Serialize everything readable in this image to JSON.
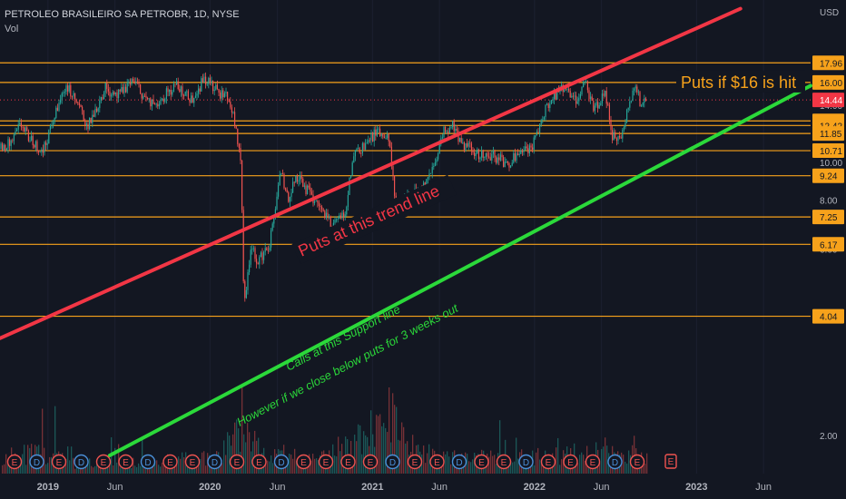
{
  "header": {
    "symbol_line": "PETROLEO BRASILEIRO SA PETROBR, 1D, NYSE",
    "vol_label": "Vol"
  },
  "chart_data": {
    "type": "candlestick",
    "currency": "USD",
    "y_scale": "log",
    "ylim": [
      1.6,
      26
    ],
    "x_range": [
      "2018-09-15",
      "2023-09-15"
    ],
    "y_ticks": [
      "2.00",
      "4.00",
      "6.00",
      "8.00",
      "10.00",
      "12.00",
      "14.00"
    ],
    "x_ticks": [
      {
        "label": "2019",
        "date": "2019-01-01"
      },
      {
        "label": "Jun",
        "date": "2019-06-01"
      },
      {
        "label": "2020",
        "date": "2020-01-01"
      },
      {
        "label": "Jun",
        "date": "2020-06-01"
      },
      {
        "label": "2021",
        "date": "2021-01-01"
      },
      {
        "label": "Jun",
        "date": "2021-06-01"
      },
      {
        "label": "2022",
        "date": "2022-01-01"
      },
      {
        "label": "Jun",
        "date": "2022-06-01"
      },
      {
        "label": "2023",
        "date": "2023-01-01"
      },
      {
        "label": "Jun",
        "date": "2023-06-01"
      }
    ],
    "levels": [
      "17.96",
      "16.00",
      "12.76",
      "12.42",
      "11.85",
      "10.71",
      "9.24",
      "7.25",
      "6.17",
      "4.04"
    ],
    "last_price": "14.44",
    "price_path": [
      {
        "date": "2018-09-15",
        "price": 10.8
      },
      {
        "date": "2018-10-10",
        "price": 11.2
      },
      {
        "date": "2018-11-01",
        "price": 12.5
      },
      {
        "date": "2018-11-20",
        "price": 11.5
      },
      {
        "date": "2018-12-20",
        "price": 10.6
      },
      {
        "date": "2019-01-20",
        "price": 13.5
      },
      {
        "date": "2019-02-10",
        "price": 15.8
      },
      {
        "date": "2019-03-10",
        "price": 14.0
      },
      {
        "date": "2019-04-01",
        "price": 12.3
      },
      {
        "date": "2019-05-10",
        "price": 15.5
      },
      {
        "date": "2019-06-10",
        "price": 14.8
      },
      {
        "date": "2019-07-10",
        "price": 16.3
      },
      {
        "date": "2019-08-20",
        "price": 14.0
      },
      {
        "date": "2019-09-15",
        "price": 14.6
      },
      {
        "date": "2019-10-15",
        "price": 15.8
      },
      {
        "date": "2019-11-20",
        "price": 14.4
      },
      {
        "date": "2019-12-20",
        "price": 16.5
      },
      {
        "date": "2020-01-20",
        "price": 15.0
      },
      {
        "date": "2020-02-10",
        "price": 14.8
      },
      {
        "date": "2020-02-25",
        "price": 12.8
      },
      {
        "date": "2020-03-10",
        "price": 10.3
      },
      {
        "date": "2020-03-18",
        "price": 4.3
      },
      {
        "date": "2020-04-01",
        "price": 6.0
      },
      {
        "date": "2020-04-20",
        "price": 5.6
      },
      {
        "date": "2020-05-15",
        "price": 6.2
      },
      {
        "date": "2020-06-08",
        "price": 9.4
      },
      {
        "date": "2020-06-25",
        "price": 8.1
      },
      {
        "date": "2020-07-15",
        "price": 9.2
      },
      {
        "date": "2020-08-10",
        "price": 8.4
      },
      {
        "date": "2020-09-10",
        "price": 7.6
      },
      {
        "date": "2020-10-01",
        "price": 6.9
      },
      {
        "date": "2020-10-30",
        "price": 7.3
      },
      {
        "date": "2020-11-20",
        "price": 10.6
      },
      {
        "date": "2020-12-20",
        "price": 11.2
      },
      {
        "date": "2021-01-10",
        "price": 11.9
      },
      {
        "date": "2021-02-10",
        "price": 11.3
      },
      {
        "date": "2021-02-22",
        "price": 7.3
      },
      {
        "date": "2021-03-20",
        "price": 8.3
      },
      {
        "date": "2021-04-20",
        "price": 8.4
      },
      {
        "date": "2021-05-20",
        "price": 9.7
      },
      {
        "date": "2021-06-10",
        "price": 11.9
      },
      {
        "date": "2021-07-01",
        "price": 12.6
      },
      {
        "date": "2021-07-20",
        "price": 11.0
      },
      {
        "date": "2021-08-10",
        "price": 10.8
      },
      {
        "date": "2021-09-01",
        "price": 10.5
      },
      {
        "date": "2021-10-01",
        "price": 10.4
      },
      {
        "date": "2021-11-01",
        "price": 9.9
      },
      {
        "date": "2021-12-01",
        "price": 10.9
      },
      {
        "date": "2021-12-25",
        "price": 10.8
      },
      {
        "date": "2022-01-20",
        "price": 13.2
      },
      {
        "date": "2022-02-15",
        "price": 14.8
      },
      {
        "date": "2022-03-10",
        "price": 15.5
      },
      {
        "date": "2022-04-01",
        "price": 14.3
      },
      {
        "date": "2022-04-25",
        "price": 16.0
      },
      {
        "date": "2022-05-15",
        "price": 13.4
      },
      {
        "date": "2022-06-08",
        "price": 15.3
      },
      {
        "date": "2022-06-25",
        "price": 11.7
      },
      {
        "date": "2022-07-12",
        "price": 11.3
      },
      {
        "date": "2022-07-28",
        "price": 13.3
      },
      {
        "date": "2022-08-15",
        "price": 15.6
      },
      {
        "date": "2022-08-28",
        "price": 14.2
      },
      {
        "date": "2022-09-10",
        "price": 14.44
      }
    ],
    "volume_path": [
      {
        "date": "2019-03-01",
        "v": 0.2
      },
      {
        "date": "2019-09-01",
        "v": 0.22
      },
      {
        "date": "2020-01-20",
        "v": 0.3
      },
      {
        "date": "2020-03-15",
        "v": 0.85
      },
      {
        "date": "2020-05-01",
        "v": 0.4
      },
      {
        "date": "2020-09-01",
        "v": 0.25
      },
      {
        "date": "2021-02-22",
        "v": 1.0
      },
      {
        "date": "2021-03-20",
        "v": 0.55
      },
      {
        "date": "2021-06-01",
        "v": 0.3
      },
      {
        "date": "2021-11-01",
        "v": 0.28
      },
      {
        "date": "2022-04-01",
        "v": 0.35
      },
      {
        "date": "2022-07-01",
        "v": 0.45
      },
      {
        "date": "2022-09-10",
        "v": 0.35
      }
    ],
    "event_markers": [
      "E",
      "D",
      "E",
      "D",
      "E",
      "E",
      "D",
      "E",
      "E",
      "D",
      "E",
      "E",
      "D",
      "E",
      "E",
      "E",
      "E",
      "D",
      "E",
      "E",
      "D",
      "E",
      "E",
      "D",
      "E",
      "E",
      "E",
      "D",
      "E"
    ],
    "trend_lines": [
      {
        "color": "#f23645",
        "points": [
          {
            "date": "2018-09-15",
            "price": 3.55
          },
          {
            "date": "2023-04-10",
            "price": 24.7
          }
        ]
      },
      {
        "color": "#2bd93a",
        "points": [
          {
            "date": "2019-05-20",
            "price": 1.78
          },
          {
            "date": "2023-09-15",
            "price": 15.7
          }
        ]
      }
    ],
    "annotations": {
      "red_label": "Puts at this trend line",
      "green_label_1": "Calls at this Support line",
      "green_label_2": "However if we close below puts for 3 weeks out",
      "target_label": "Puts if $16 is hit"
    },
    "colors": {
      "background": "#131722",
      "level_line": "#f7a21b",
      "resistance_line": "#f23645",
      "support_line": "#2bd93a",
      "candle_up": "#26a69a",
      "candle_down": "#ef5350",
      "last_price_badge": "#f23645",
      "axis_text": "#b2b5be"
    }
  }
}
